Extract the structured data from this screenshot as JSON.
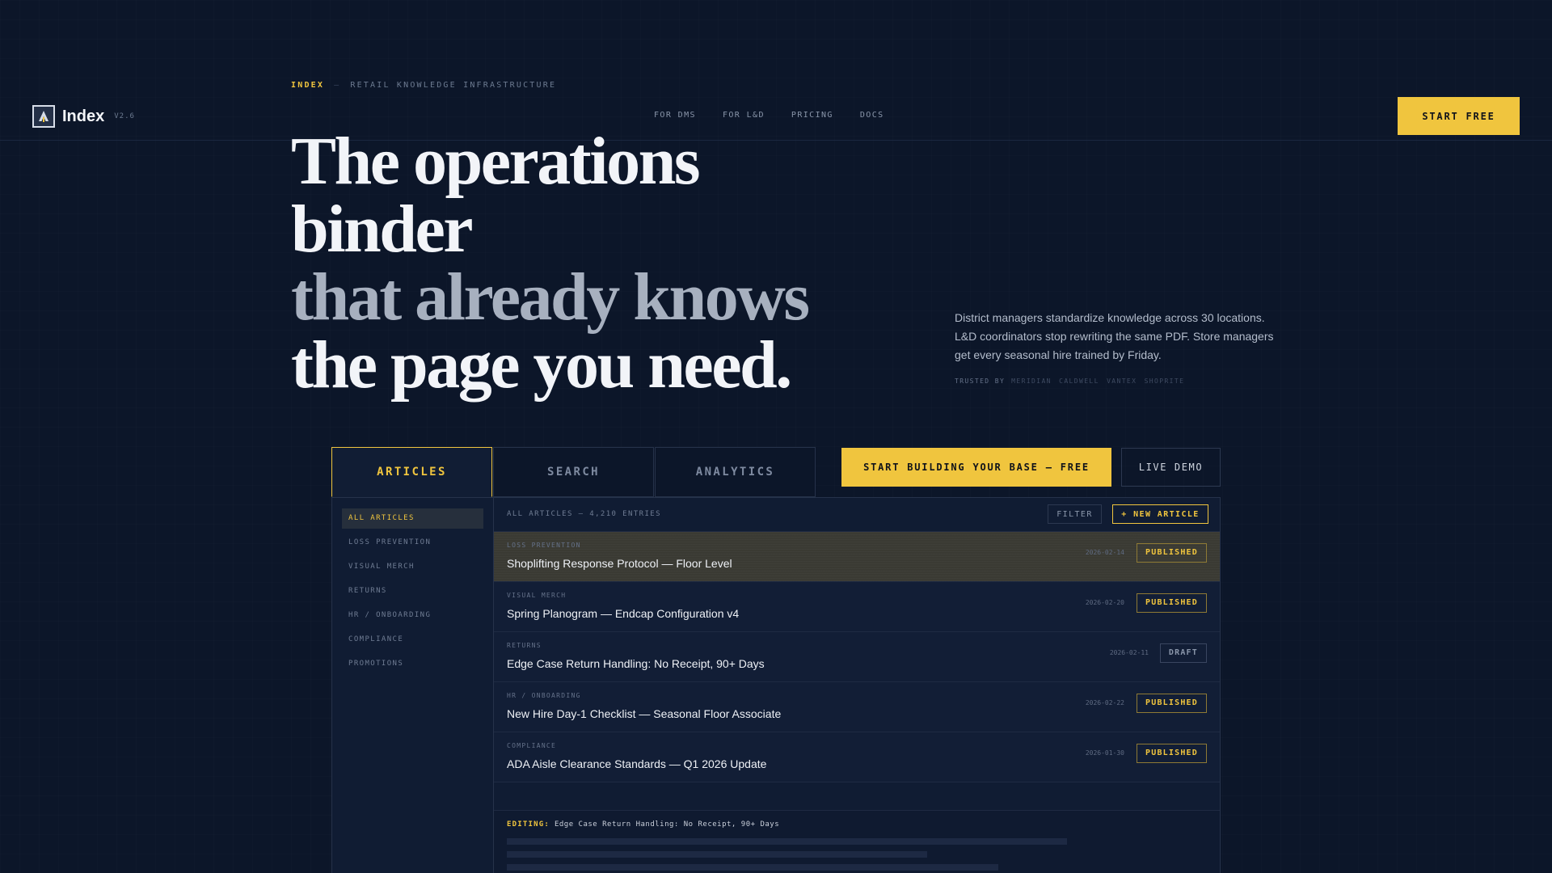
{
  "eyebrow": {
    "brand": "INDEX",
    "dash": "—",
    "tagline": "RETAIL KNOWLEDGE INFRASTRUCTURE"
  },
  "header": {
    "logo_name": "Index",
    "version": "V2.6",
    "nav": [
      "FOR DMS",
      "FOR L&D",
      "PRICING",
      "DOCS"
    ],
    "cta": "START FREE"
  },
  "hero": {
    "line1": "The operations",
    "line2": "binder",
    "line3": "that already knows",
    "line4": "the page you need.",
    "description": "District managers standardize knowledge across 30 locations. L&D coordinators stop rewriting the same PDF. Store managers get every seasonal hire trained by Friday.",
    "trusted_label": "TRUSTED BY",
    "trusted_brands": "MERIDIAN CALDWELL VANTEX SHOPRITE"
  },
  "app": {
    "tabs": [
      "ARTICLES",
      "SEARCH",
      "ANALYTICS"
    ],
    "active_tab": "ARTICLES",
    "cta_build": "START BUILDING YOUR BASE — FREE",
    "cta_demo": "LIVE DEMO",
    "sidebar": [
      "ALL ARTICLES",
      "LOSS PREVENTION",
      "VISUAL MERCH",
      "RETURNS",
      "HR / ONBOARDING",
      "COMPLIANCE",
      "PROMOTIONS"
    ],
    "list_count": "ALL ARTICLES — 4,210 ENTRIES",
    "filter_label": "FILTER",
    "new_article_label": "+ NEW ARTICLE",
    "rows": [
      {
        "category": "LOSS PREVENTION",
        "title": "Shoplifting Response Protocol — Floor Level",
        "date": "2026-02-14",
        "status": "PUBLISHED"
      },
      {
        "category": "VISUAL MERCH",
        "title": "Spring Planogram — Endcap Configuration v4",
        "date": "2026-02-20",
        "status": "PUBLISHED"
      },
      {
        "category": "RETURNS",
        "title": "Edge Case Return Handling: No Receipt, 90+ Days",
        "date": "2026-02-11",
        "status": "DRAFT"
      },
      {
        "category": "HR / ONBOARDING",
        "title": "New Hire Day-1 Checklist — Seasonal Floor Associate",
        "date": "2026-02-22",
        "status": "PUBLISHED"
      },
      {
        "category": "COMPLIANCE",
        "title": "ADA Aisle Clearance Standards — Q1 2026 Update",
        "date": "2026-01-30",
        "status": "PUBLISHED"
      }
    ],
    "editing_label": "EDITING:",
    "editing_title": "Edge Case Return Handling: No Receipt, 90+ Days"
  },
  "colors": {
    "background": "#0c1629",
    "accent": "#f0c53e",
    "panel": "#101c33"
  }
}
